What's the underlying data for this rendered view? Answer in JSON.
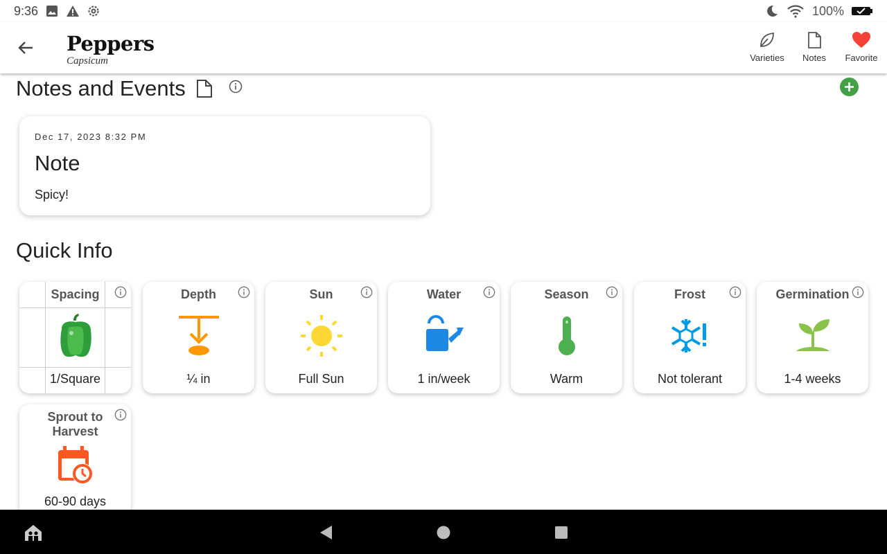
{
  "status_bar": {
    "time": "9:36",
    "battery": "100%"
  },
  "app_bar": {
    "title": "Peppers",
    "subtitle": "Capsicum",
    "actions": [
      {
        "label": "Varieties",
        "icon": "leaf-icon"
      },
      {
        "label": "Notes",
        "icon": "note-icon"
      },
      {
        "label": "Favorite",
        "icon": "heart-icon"
      }
    ]
  },
  "notes_section": {
    "title": "Notes and Events",
    "notes": [
      {
        "date": "Dec 17, 2023 8:32 PM",
        "title": "Note",
        "body": "Spicy!"
      }
    ]
  },
  "quick_info": {
    "title": "Quick Info",
    "cards": [
      {
        "label": "Spacing",
        "value": "1/Square",
        "icon": "pepper-icon"
      },
      {
        "label": "Depth",
        "value": "¼ in",
        "icon": "depth-icon"
      },
      {
        "label": "Sun",
        "value": "Full Sun",
        "icon": "sun-icon"
      },
      {
        "label": "Water",
        "value": "1 in/week",
        "icon": "watering-can-icon"
      },
      {
        "label": "Season",
        "value": "Warm",
        "icon": "thermometer-icon"
      },
      {
        "label": "Frost",
        "value": "Not tolerant",
        "icon": "snowflake-alert-icon"
      },
      {
        "label": "Germination",
        "value": "1-4 weeks",
        "icon": "sprout-icon"
      },
      {
        "label": "Sprout to Harvest",
        "value": "60-90 days",
        "icon": "calendar-clock-icon"
      }
    ]
  },
  "colors": {
    "accent_green": "#43a047",
    "heart_red": "#f44336",
    "depth_orange": "#ff9800",
    "sun_yellow": "#fdd835",
    "water_blue": "#1e88e5",
    "season_green": "#4caf50",
    "frost_blue": "#039be5",
    "sprout_green": "#8bc34a",
    "calendar_orange": "#ff5722"
  }
}
